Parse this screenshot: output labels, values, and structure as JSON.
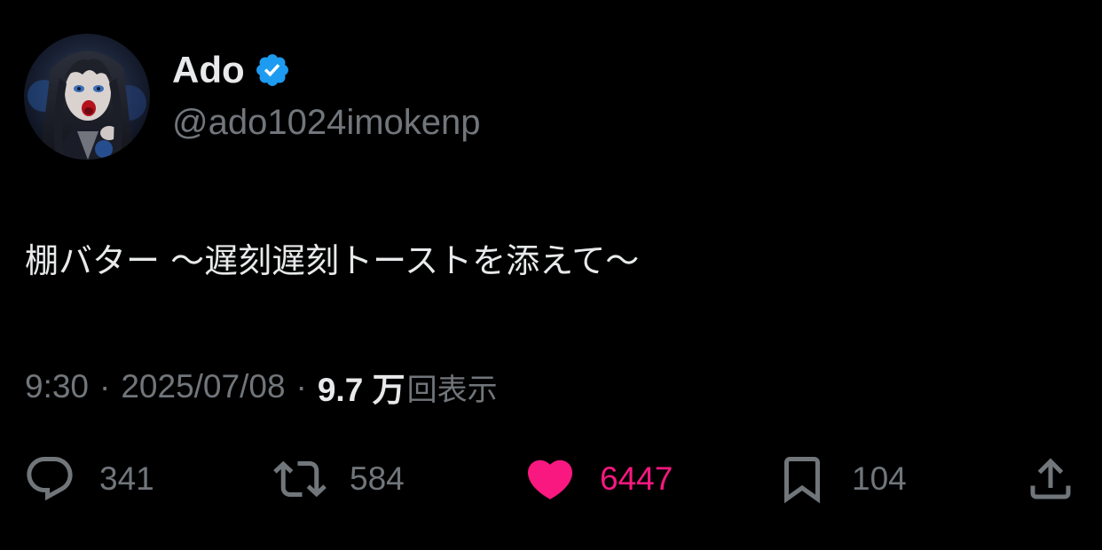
{
  "author": {
    "display_name": "Ado",
    "handle": "@ado1024imokenp",
    "verified": true,
    "avatar_icon": "avatar-image"
  },
  "tweet": {
    "text": "棚バター 〜遅刻遅刻トーストを添えて〜",
    "time": "9:30",
    "separator": "·",
    "date": "2025/07/08",
    "views_count": "9.7 万",
    "views_label": "回表示"
  },
  "actions": {
    "reply": {
      "icon": "reply-icon",
      "count": "341"
    },
    "repost": {
      "icon": "repost-icon",
      "count": "584"
    },
    "like": {
      "icon": "heart-icon",
      "count": "6447",
      "liked": true
    },
    "bookmark": {
      "icon": "bookmark-icon",
      "count": "104"
    },
    "share": {
      "icon": "share-icon"
    }
  },
  "colors": {
    "background": "#000000",
    "primary_text": "#e7e9ea",
    "secondary_text": "#71767b",
    "verified_blue": "#1d9bf0",
    "like_pink": "#f91880"
  }
}
